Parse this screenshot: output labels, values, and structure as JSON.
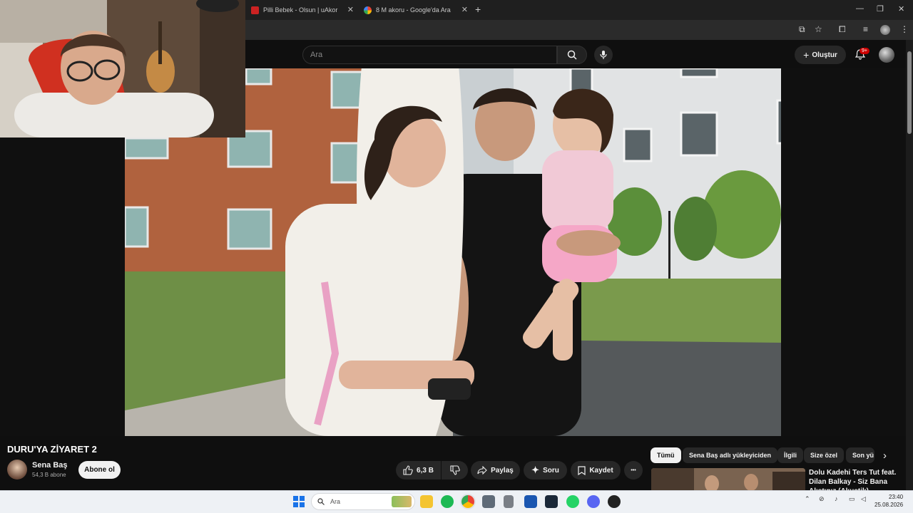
{
  "browser": {
    "tabs": [
      {
        "title": "Pilli Bebek - Olsun | uAkor",
        "active": false
      },
      {
        "title": "8 M akoru - Google'da Ara",
        "active": false
      }
    ],
    "new_tab_glyph": "+",
    "window_controls": [
      "—",
      "❐",
      "✕"
    ]
  },
  "youtube": {
    "search": {
      "placeholder": "Ara"
    },
    "create_label": "Oluştur",
    "notification_badge": "9+",
    "video": {
      "title": "DURU'YA ZİYARET 2",
      "channel": "Sena Baş",
      "subscribers": "54,3 B abone",
      "subscribe_label": "Abone ol",
      "likes": "6,3 B",
      "share_label": "Paylaş",
      "ask_label": "Soru",
      "save_label": "Kaydet",
      "more_glyph": "•••"
    },
    "chips": [
      {
        "label": "Tümü",
        "active": true
      },
      {
        "label": "Sena Baş adlı yükleyiciden",
        "active": false
      },
      {
        "label": "İlgili",
        "active": false
      },
      {
        "label": "Size özel",
        "active": false
      },
      {
        "label": "Son yü",
        "active": false
      }
    ],
    "recommendation": {
      "title": "Dolu Kadehi Ters Tut feat. Dilan Balkay - Siz Bana Alıştınız (Akustik)"
    }
  },
  "taskbar": {
    "search_placeholder": "Ara",
    "time": "23:40",
    "date": "25.08.2026"
  },
  "colors": {
    "youtube_bg": "#0f0f0f",
    "accent_red": "#cc0000",
    "taskbar_bg": "#eef1f5"
  }
}
